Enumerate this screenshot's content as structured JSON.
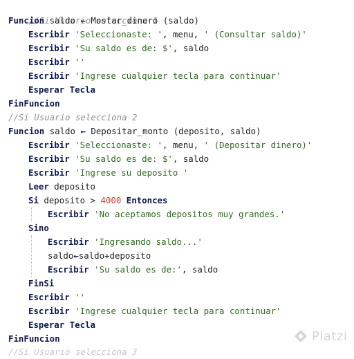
{
  "code": {
    "l1": {
      "c": "//Si Usuario selecciona 1"
    },
    "l2": {
      "kw": "Funcion",
      "a": " saldo ",
      "arrow": "←",
      "b": " Mostar_dinero (saldo)"
    },
    "l3": {
      "kw": "Escribir",
      "s1": "'Seleccionaste: '",
      "p1": ", menu, ",
      "s2": "' (Consultar saldo)'"
    },
    "l4": {
      "kw": "Escribir",
      "s1": "'Su saldo es de: $'",
      "p1": ", saldo"
    },
    "l5": {
      "kw": "Escribir",
      "s1": "''"
    },
    "l6": {
      "kw": "Escribir",
      "s1": "'Ingrese cualquier tecla para continuar'"
    },
    "l7": {
      "kw": "Esperar Tecla"
    },
    "l8": {
      "kw": "FinFuncion"
    },
    "l9": {
      "c": "//Si Usuario selecciona 2"
    },
    "l10": {
      "kw": "Funcion",
      "a": " saldo ",
      "arrow": "←",
      "b": " Depositar_monto (deposito, saldo)"
    },
    "l11": {
      "kw": "Escribir",
      "s1": "'Seleccionaste: '",
      "p1": ", menu, ",
      "s2": "' (Depositar dinero)'"
    },
    "l12": {
      "kw": "Escribir",
      "s1": "'Su saldo es de: $'",
      "p1": ", saldo"
    },
    "l13": {
      "kw": "Escribir",
      "s1": "'Ingrese su deposito '"
    },
    "l14": {
      "kw": "Leer",
      "p1": " deposito"
    },
    "l15": {
      "kw": "Si",
      "p1": " deposito > ",
      "num": "4000",
      "kw2": "Entonces"
    },
    "l16": {
      "kw": "Escribir",
      "s1": "'No aceptamos depositos muy grandes.'"
    },
    "l17": {
      "kw": "Sino"
    },
    "l18": {
      "kw": "Escribir",
      "s1": "'Ingresando saldo...'"
    },
    "l19": {
      "p1": "saldo",
      "arrow": "←",
      "p2": "saldo+deposito"
    },
    "l20": {
      "kw": "Escribir",
      "s1": "'Su saldo es de:'",
      "p1": ", saldo"
    },
    "l21": {
      "kw": "FinSi"
    },
    "l22": {
      "kw": "Escribir",
      "s1": "''"
    },
    "l23": {
      "kw": "Escribir",
      "s1": "'Ingrese cualquier tecla para continuar'"
    },
    "l24": {
      "kw": "Esperar Tecla"
    },
    "l25": {
      "kw": "FinFuncion"
    },
    "l26": {
      "c": "//Si Usuario selecciona 3"
    }
  },
  "watermark": {
    "text": "Platzi",
    "icon": "platzi-logo-icon"
  },
  "colors": {
    "keyword": "#0d1a4d",
    "string": "#2e6b1f",
    "number": "#c2452d",
    "comment": "#8f8f8f"
  }
}
